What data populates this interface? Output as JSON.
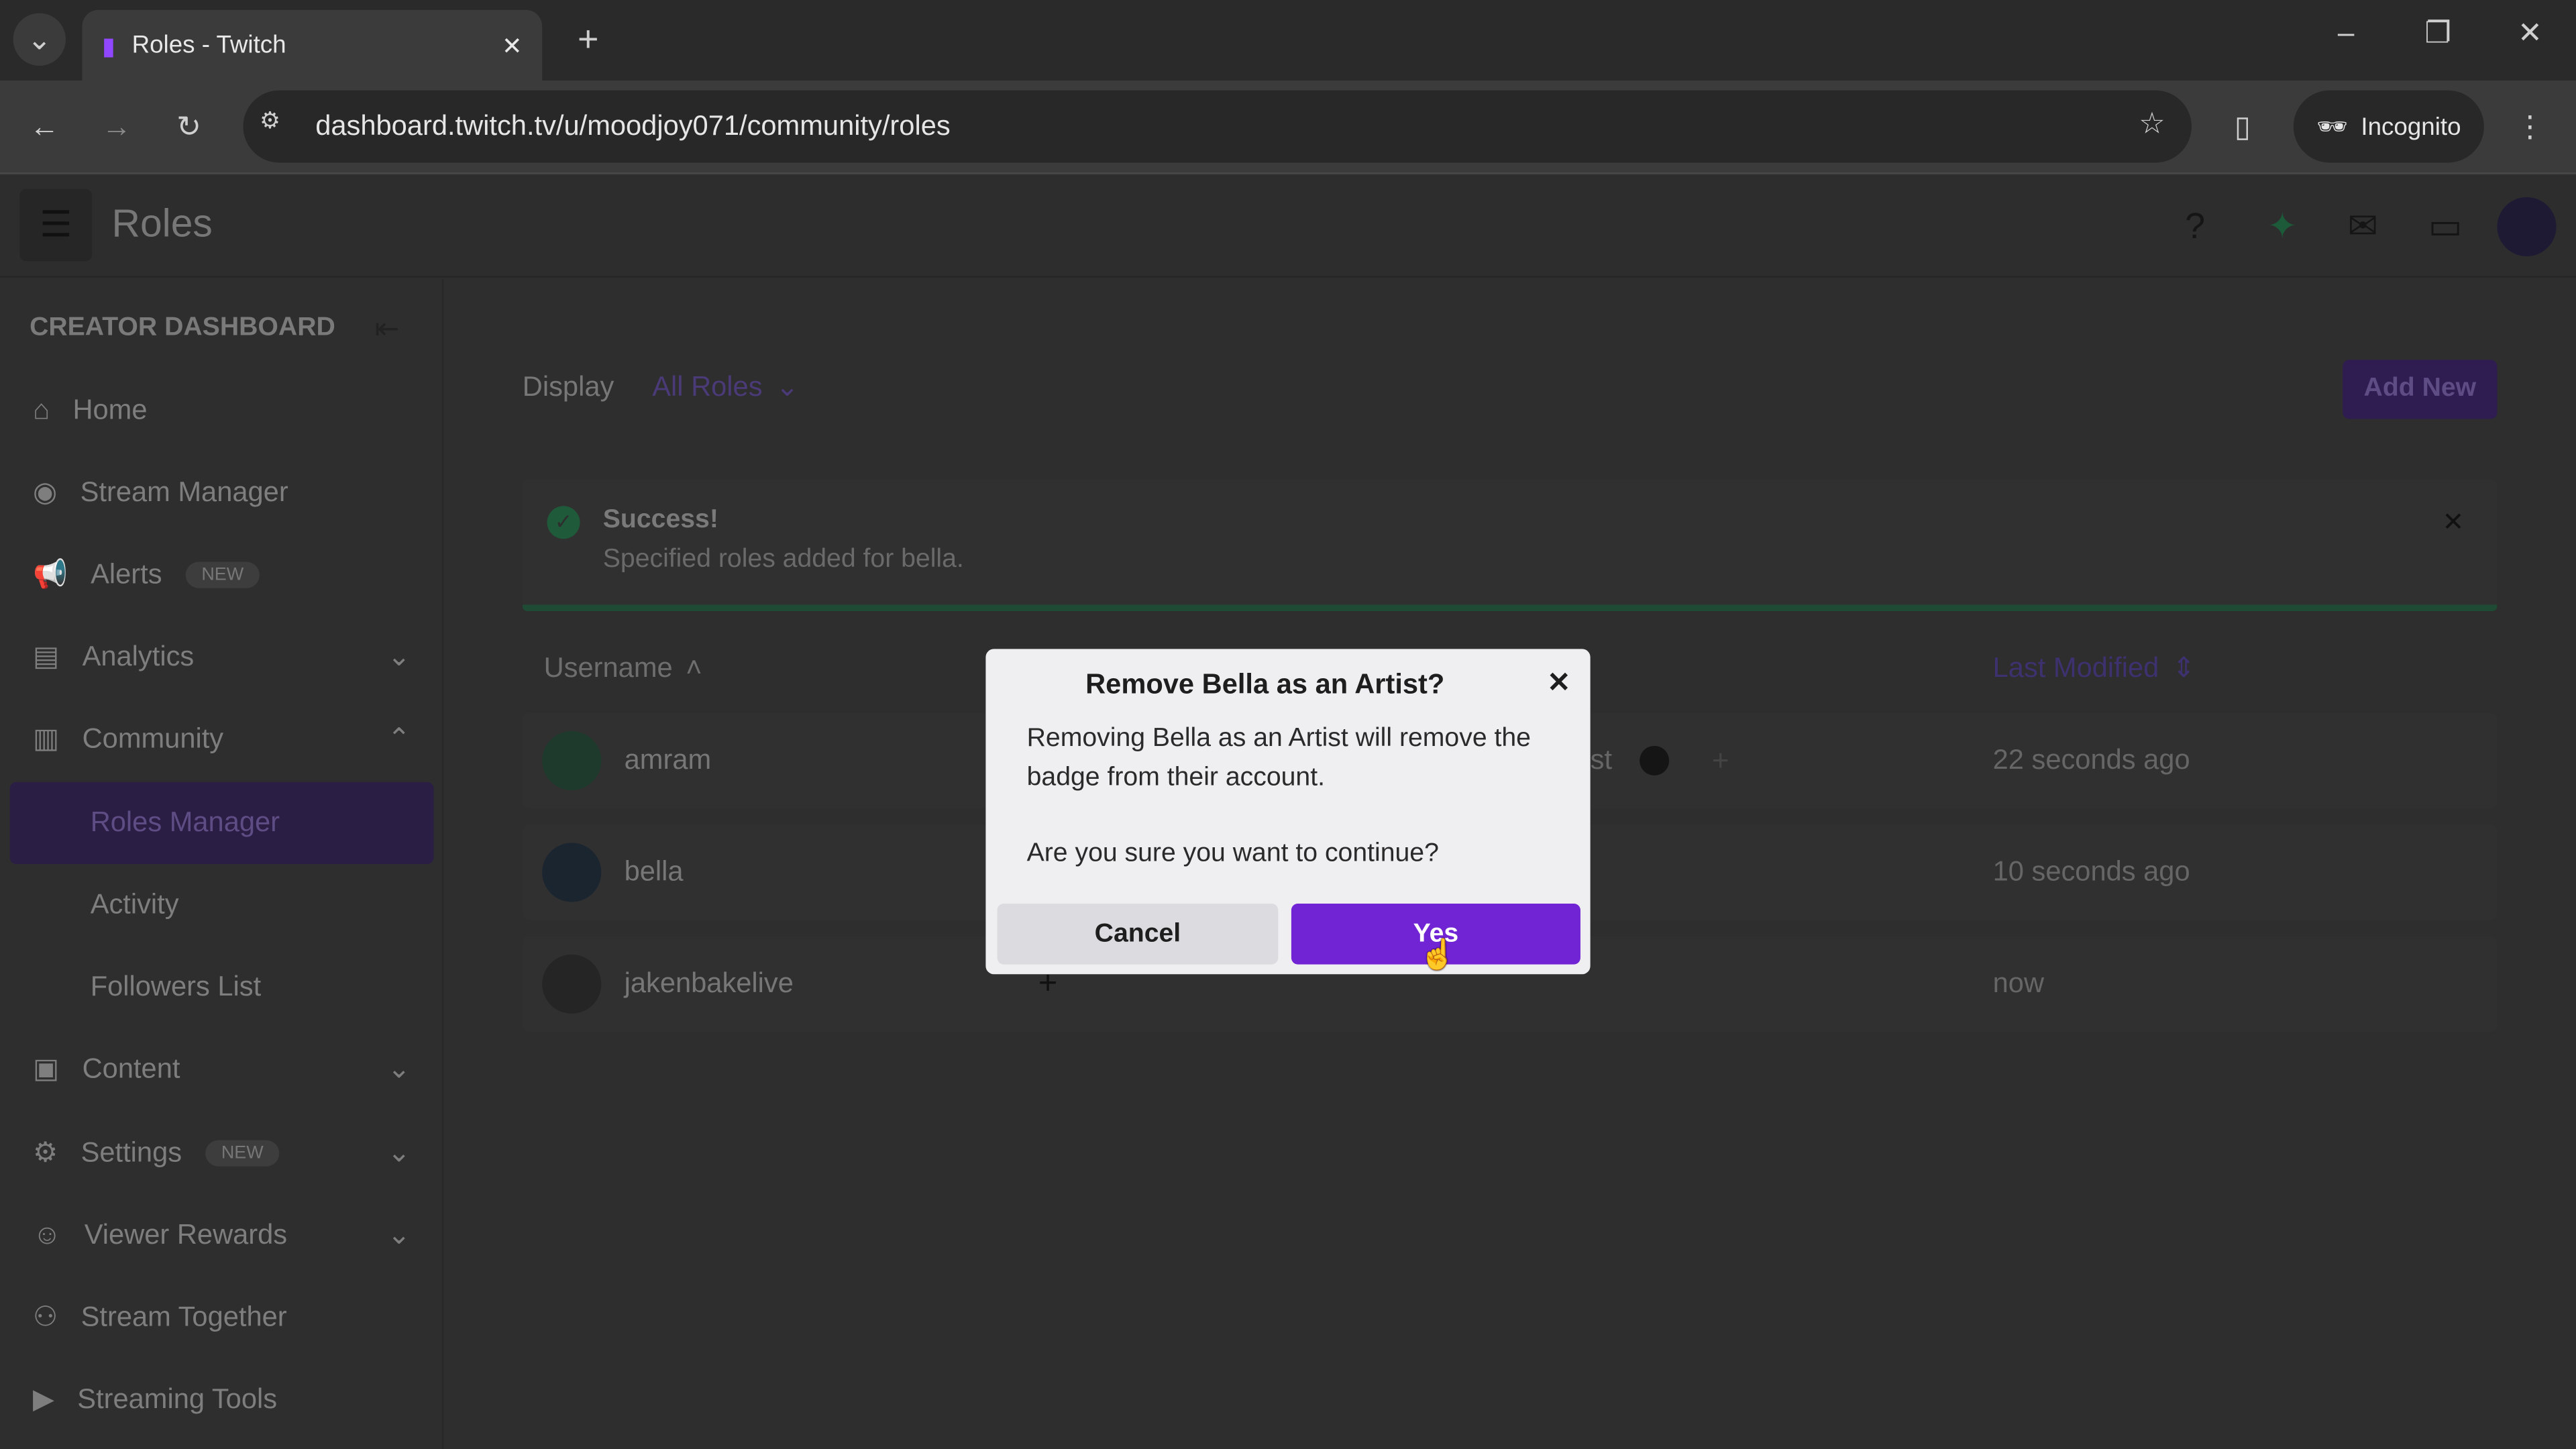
{
  "browser": {
    "tab_title": "Roles - Twitch",
    "url": "dashboard.twitch.tv/u/moodjoy071/community/roles",
    "incognito_label": "Incognito"
  },
  "header": {
    "title": "Roles"
  },
  "sidebar": {
    "heading": "CREATOR DASHBOARD",
    "items": [
      {
        "label": "Home",
        "icon": "home-icon"
      },
      {
        "label": "Stream Manager",
        "icon": "broadcast-icon"
      },
      {
        "label": "Alerts",
        "icon": "megaphone-icon",
        "badge": "NEW"
      },
      {
        "label": "Analytics",
        "icon": "chart-icon"
      },
      {
        "label": "Community",
        "icon": "community-icon"
      },
      {
        "label": "Roles Manager"
      },
      {
        "label": "Activity"
      },
      {
        "label": "Followers List"
      },
      {
        "label": "Content",
        "icon": "content-icon"
      },
      {
        "label": "Settings",
        "icon": "gear-icon",
        "badge": "NEW"
      },
      {
        "label": "Viewer Rewards",
        "icon": "rewards-icon"
      },
      {
        "label": "Stream Together",
        "icon": "user-plus-icon"
      },
      {
        "label": "Streaming Tools",
        "icon": "camera-icon"
      }
    ]
  },
  "filter": {
    "label": "Display",
    "value": "All Roles"
  },
  "add_new": "Add New",
  "alert": {
    "title": "Success!",
    "message": "Specified roles added for bella."
  },
  "table": {
    "col_username": "Username",
    "col_modified": "Last Modified",
    "rows": [
      {
        "username": "amram",
        "role_partial": "st",
        "modified": "22 seconds ago"
      },
      {
        "username": "bella",
        "modified": "10 seconds ago"
      },
      {
        "username": "jakenbakelive",
        "modified": "now"
      }
    ]
  },
  "modal": {
    "title": "Remove Bella as an Artist?",
    "body": "Removing Bella as an Artist will remove the badge from their account.",
    "question": "Are you sure you want to continue?",
    "cancel": "Cancel",
    "confirm": "Yes"
  },
  "colors": {
    "accent": "#7124d4",
    "success": "#2a9a5a",
    "modal_bg": "#efeff1"
  }
}
